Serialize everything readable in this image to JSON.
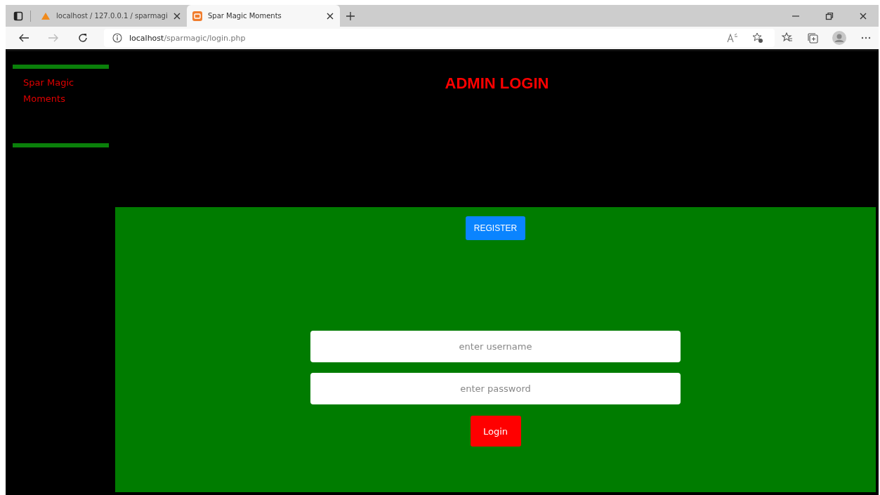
{
  "browser": {
    "tabs": [
      {
        "title": "localhost / 127.0.0.1 / sparmagi",
        "selected": false
      },
      {
        "title": "Spar Magic Moments",
        "selected": true
      }
    ],
    "url": {
      "host": "localhost",
      "path": "/sparmagic/login.php"
    }
  },
  "sidebar": {
    "brand": "Spar Magic Moments"
  },
  "header": {
    "title": "ADMIN LOGIN"
  },
  "panel": {
    "register_button": "REGISTER",
    "fields": [
      {
        "placeholder": "enter username"
      },
      {
        "placeholder": "enter password"
      }
    ],
    "login_button": "Login"
  }
}
